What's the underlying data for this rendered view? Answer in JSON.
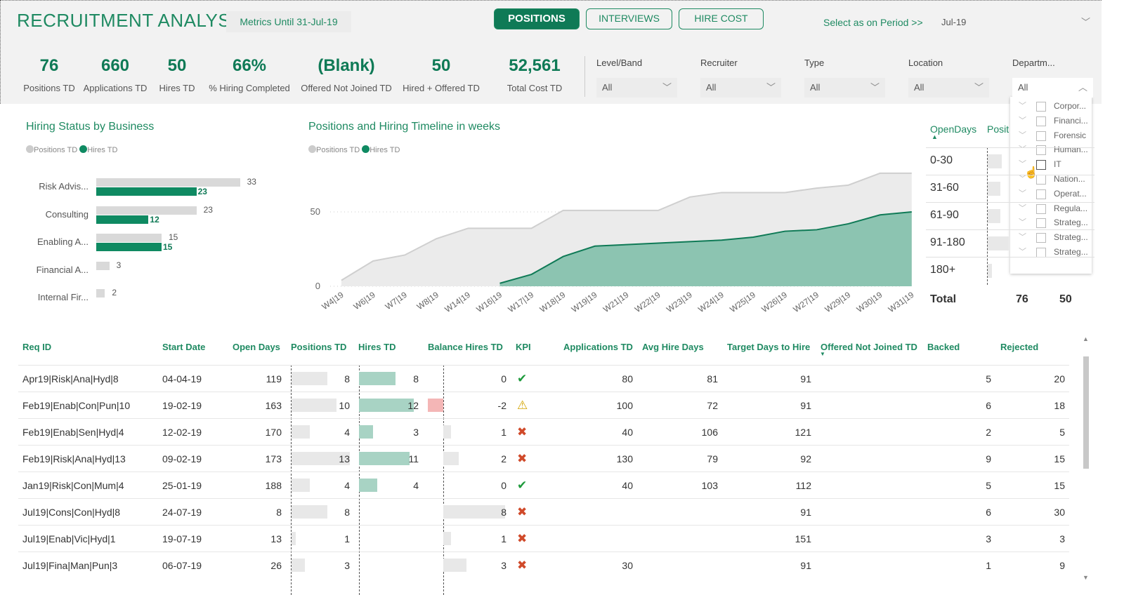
{
  "header": {
    "title": "RECRUITMENT ANALYSIS",
    "metrics_until": "Metrics Until 31-Jul-19",
    "nav": [
      {
        "label": "POSITIONS",
        "active": true
      },
      {
        "label": "INTERVIEWS",
        "active": false
      },
      {
        "label": "HIRE COST",
        "active": false
      }
    ],
    "period_label": "Select as on Period >>",
    "period_value": "Jul-19"
  },
  "kpis": [
    {
      "value": "76",
      "label": "Positions TD"
    },
    {
      "value": "660",
      "label": "Applications TD"
    },
    {
      "value": "50",
      "label": "Hires TD"
    },
    {
      "value": "66%",
      "label": "% Hiring Completed"
    },
    {
      "value": "(Blank)",
      "label": "Offered Not Joined TD"
    },
    {
      "value": "50",
      "label": "Hired + Offered TD"
    },
    {
      "value": "52,561",
      "label": "Total Cost TD"
    }
  ],
  "filters": [
    {
      "label": "Level/Band",
      "value": "All"
    },
    {
      "label": "Recruiter",
      "value": "All"
    },
    {
      "label": "Type",
      "value": "All"
    },
    {
      "label": "Location",
      "value": "All"
    },
    {
      "label": "Departm...",
      "value": "All",
      "open": true
    }
  ],
  "department_options": [
    "Corpor...",
    "Financi...",
    "Forensic",
    "Human...",
    "IT",
    "Nation...",
    "Operat...",
    "Regula...",
    "Strateg...",
    "Strateg...",
    "Strateg..."
  ],
  "colors": {
    "accent": "#0f7a56",
    "positions": "#d9d9d9",
    "hires": "#0f8a62",
    "hires_fill": "#8cc4b1",
    "negative": "#f4b6b6"
  },
  "chart_data": [
    {
      "type": "bar",
      "title": "Hiring Status by Business",
      "legend": [
        "Positions TD",
        "Hires TD"
      ],
      "legend_position": "top-left",
      "categories": [
        "Risk Advis...",
        "Consulting",
        "Enabling A...",
        "Financial A...",
        "Internal Fir..."
      ],
      "series": [
        {
          "name": "Positions TD",
          "values": [
            33,
            23,
            15,
            3,
            2
          ]
        },
        {
          "name": "Hires TD",
          "values": [
            23,
            12,
            15,
            null,
            null
          ]
        }
      ]
    },
    {
      "type": "area",
      "title": "Positions and Hiring Timeline in weeks",
      "legend": [
        "Positions TD",
        "Hires TD"
      ],
      "legend_position": "top-left",
      "x": [
        "W4|19",
        "W6|19",
        "W7|19",
        "W8|19",
        "W14|19",
        "W16|19",
        "W17|19",
        "W18|19",
        "W19|19",
        "W21|19",
        "W22|19",
        "W23|19",
        "W24|19",
        "W25|19",
        "W26|19",
        "W27|19",
        "W29|19",
        "W30|19",
        "W31|19"
      ],
      "yticks": [
        "0",
        "50"
      ],
      "ylim": [
        0,
        80
      ],
      "grid": true,
      "series": [
        {
          "name": "Positions TD",
          "values": [
            4,
            17,
            21,
            32,
            39,
            39,
            39,
            51,
            51,
            51,
            51,
            60,
            63,
            63,
            63,
            66,
            68,
            76,
            76
          ]
        },
        {
          "name": "Hires TD",
          "values": [
            null,
            null,
            null,
            null,
            null,
            2,
            8,
            20,
            27,
            28,
            29,
            30,
            31,
            33,
            37,
            38,
            42,
            48,
            50
          ]
        }
      ]
    }
  ],
  "opendays": {
    "headers": [
      "OpenDays",
      "Posit"
    ],
    "rows": [
      "0-30",
      "31-60",
      "61-90",
      "91-180",
      "180+"
    ],
    "total_label": "Total",
    "total_positions": "76",
    "total_hires": "50"
  },
  "table": {
    "headers": [
      "Req ID",
      "Start Date",
      "Open Days",
      "Positions TD",
      "Hires TD",
      "Balance Hires TD",
      "KPI",
      "Applications TD",
      "Avg Hire Days",
      "Target Days to Hire",
      "Offered Not Joined TD",
      "Backed",
      "Rejected"
    ],
    "rows": [
      [
        "Apr19|Risk|Ana|Hyd|8",
        "04-04-19",
        "119",
        "8",
        "8",
        "0",
        "check",
        "80",
        "81",
        "91",
        "",
        "5",
        "20"
      ],
      [
        "Feb19|Enab|Con|Pun|10",
        "19-02-19",
        "163",
        "10",
        "12",
        "-2",
        "warning",
        "100",
        "72",
        "91",
        "",
        "6",
        "18"
      ],
      [
        "Feb19|Enab|Sen|Hyd|4",
        "12-02-19",
        "170",
        "4",
        "3",
        "1",
        "cross",
        "40",
        "106",
        "121",
        "",
        "2",
        "5"
      ],
      [
        "Feb19|Risk|Ana|Hyd|13",
        "09-02-19",
        "173",
        "13",
        "11",
        "2",
        "cross",
        "130",
        "79",
        "92",
        "",
        "9",
        "15"
      ],
      [
        "Jan19|Risk|Con|Mum|4",
        "25-01-19",
        "188",
        "4",
        "4",
        "0",
        "check",
        "40",
        "103",
        "112",
        "",
        "5",
        "15"
      ],
      [
        "Jul19|Cons|Con|Hyd|8",
        "24-07-19",
        "8",
        "8",
        "",
        "8",
        "cross",
        "",
        "",
        "91",
        "",
        "6",
        "30"
      ],
      [
        "Jul19|Enab|Vic|Hyd|1",
        "19-07-19",
        "13",
        "1",
        "",
        "1",
        "cross",
        "",
        "",
        "151",
        "",
        "3",
        "3"
      ],
      [
        "Jul19|Fina|Man|Pun|3",
        "06-07-19",
        "26",
        "3",
        "",
        "3",
        "cross",
        "30",
        "",
        "91",
        "",
        "1",
        "9"
      ]
    ]
  }
}
